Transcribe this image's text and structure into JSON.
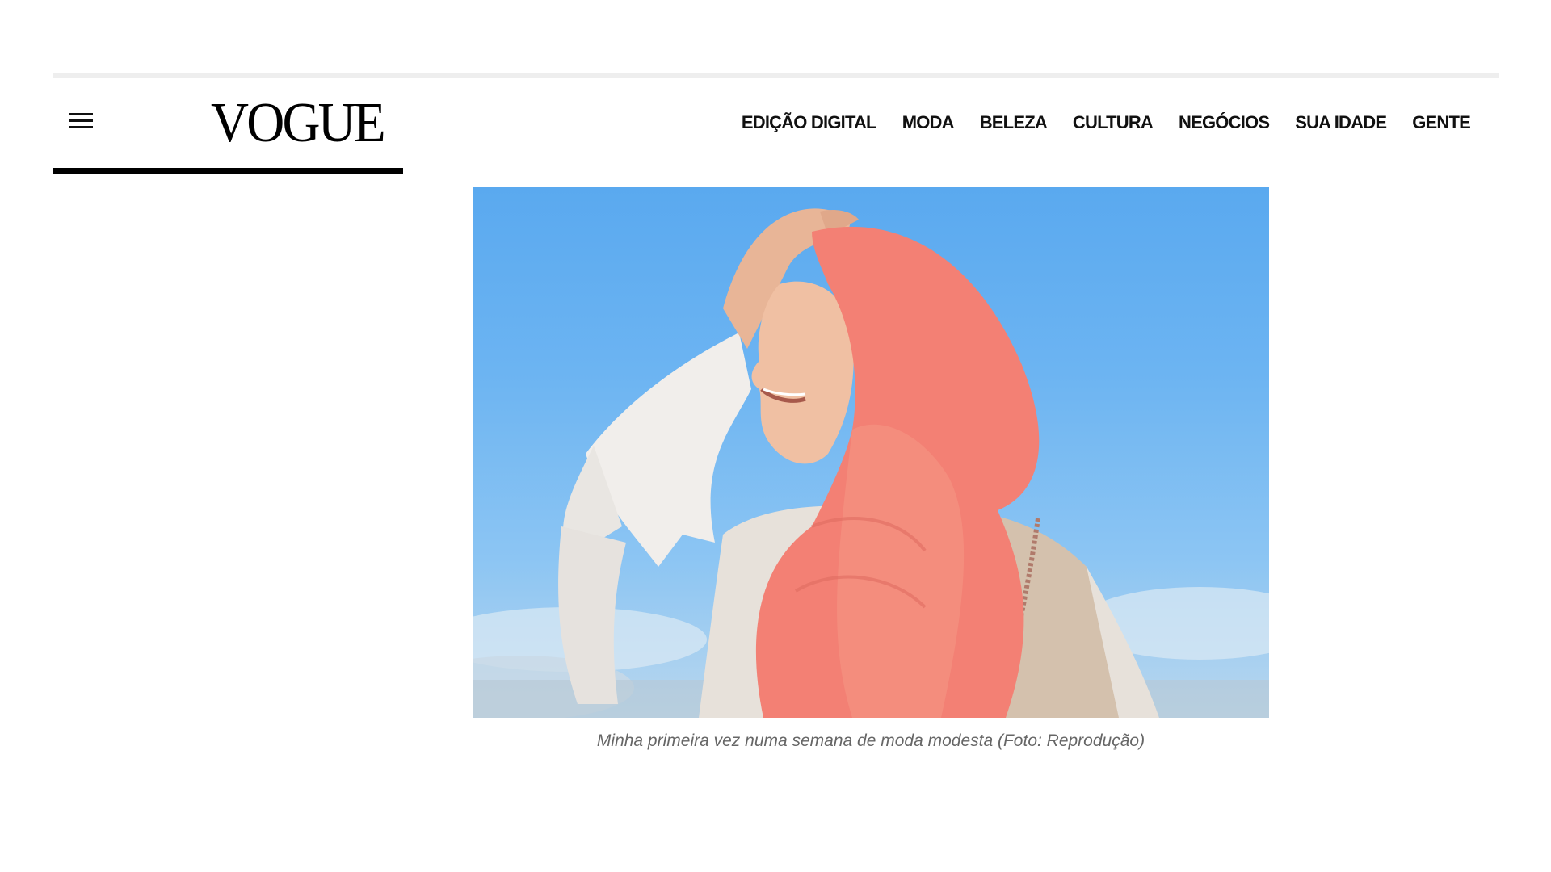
{
  "header": {
    "logo_text": "VOGUE",
    "menu_icon": "hamburger-menu-icon",
    "nav": [
      {
        "label": "EDIÇÃO DIGITAL"
      },
      {
        "label": "MODA"
      },
      {
        "label": "BELEZA"
      },
      {
        "label": "CULTURA"
      },
      {
        "label": "NEGÓCIOS"
      },
      {
        "label": "SUA IDADE"
      },
      {
        "label": "GENTE"
      }
    ]
  },
  "article": {
    "image_caption": "Minha primeira vez numa semana de moda modesta (Foto: Reprodução)"
  },
  "colors": {
    "text": "#111111",
    "caption": "#666666",
    "rule": "#eeeeee",
    "logo_underline": "#000000"
  }
}
